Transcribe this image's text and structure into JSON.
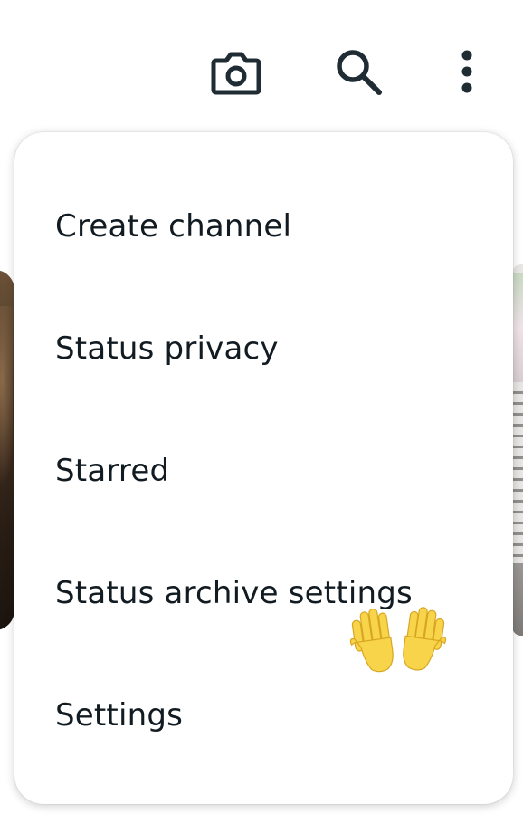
{
  "topbar": {
    "icons": [
      {
        "name": "camera-icon"
      },
      {
        "name": "search-icon"
      },
      {
        "name": "more-vert-icon"
      }
    ]
  },
  "menu": {
    "items": [
      {
        "label": "Create channel"
      },
      {
        "label": "Status privacy"
      },
      {
        "label": "Starred"
      },
      {
        "label": "Status archive settings"
      },
      {
        "label": "Settings"
      }
    ]
  },
  "decor": {
    "emoji": "raised-hands-emoji"
  },
  "colors": {
    "text": "#111b21",
    "icon": "#1f2c34",
    "menu_bg": "#ffffff",
    "emoji_fill": "#f7d44a"
  }
}
